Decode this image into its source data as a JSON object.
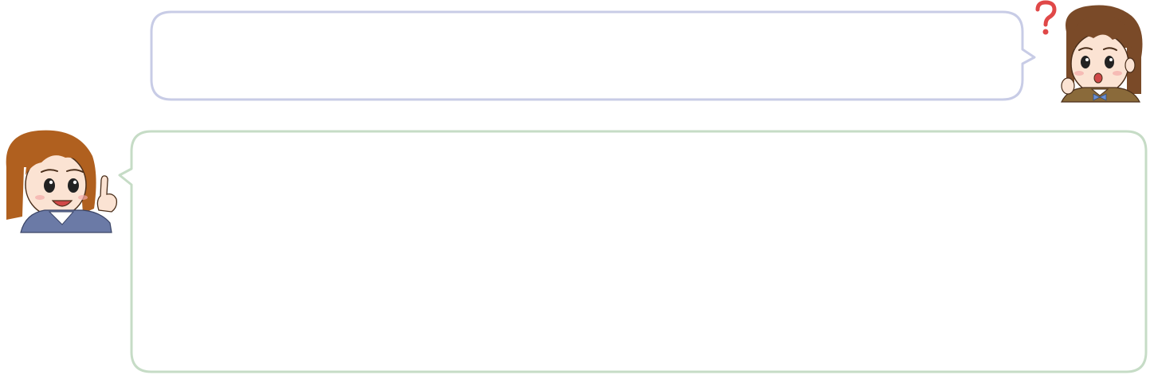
{
  "dialogue": {
    "question_bubble": {
      "text": "",
      "border_color": "#c8cce6"
    },
    "answer_bubble": {
      "text": "",
      "border_color": "#c6dcc6"
    }
  },
  "characters": {
    "student": {
      "icon": "question-mark-icon",
      "hair_color": "#7a4a28",
      "uniform_color": "#8a6a3a",
      "accent_color": "#e04848"
    },
    "teacher": {
      "icon": "pointing-finger-icon",
      "hair_color": "#b0601f",
      "jacket_color": "#6b7aa6"
    }
  }
}
